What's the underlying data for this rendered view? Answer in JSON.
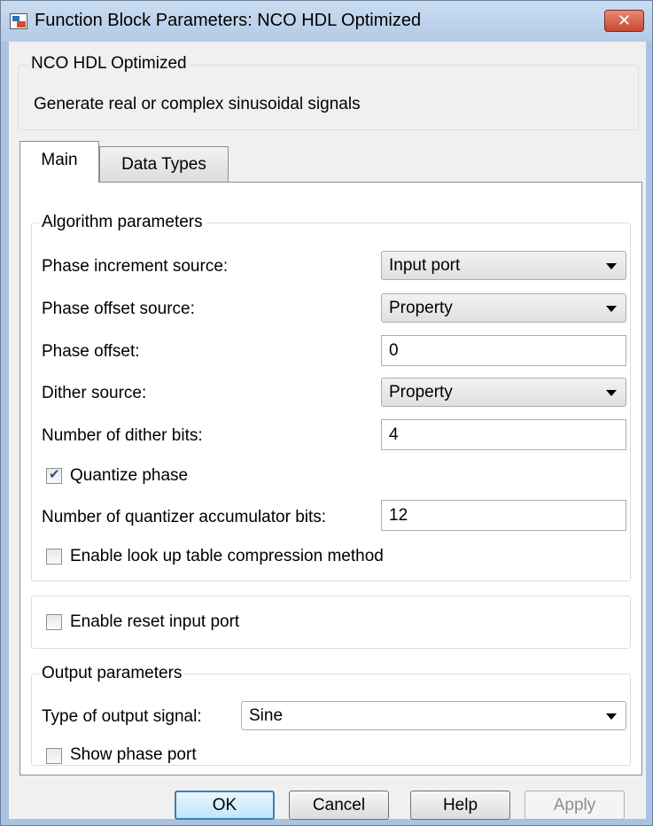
{
  "window": {
    "title": "Function Block Parameters: NCO HDL Optimized",
    "close_glyph": "✕"
  },
  "description": {
    "legend": "NCO HDL Optimized",
    "text": "Generate real or complex sinusoidal signals"
  },
  "tabs": [
    {
      "label": "Main",
      "active": true
    },
    {
      "label": "Data Types",
      "active": false
    }
  ],
  "algorithm": {
    "legend": "Algorithm parameters",
    "phase_increment_source": {
      "label": "Phase increment source:",
      "value": "Input port"
    },
    "phase_offset_source": {
      "label": "Phase offset source:",
      "value": "Property"
    },
    "phase_offset": {
      "label": "Phase offset:",
      "value": "0"
    },
    "dither_source": {
      "label": "Dither source:",
      "value": "Property"
    },
    "dither_bits": {
      "label": "Number of dither bits:",
      "value": "4"
    },
    "quantize_phase": {
      "label": "Quantize phase",
      "checked": true
    },
    "quantizer_bits": {
      "label": "Number of quantizer accumulator bits:",
      "value": "12"
    },
    "lut_compression": {
      "label": "Enable look up table compression method",
      "checked": false
    }
  },
  "reset": {
    "label": "Enable reset input port",
    "checked": false
  },
  "output": {
    "legend": "Output parameters",
    "signal_type": {
      "label": "Type of output signal:",
      "value": "Sine"
    },
    "show_phase_port": {
      "label": "Show phase port",
      "checked": false
    }
  },
  "buttons": {
    "ok": "OK",
    "cancel": "Cancel",
    "help": "Help",
    "apply": "Apply"
  }
}
